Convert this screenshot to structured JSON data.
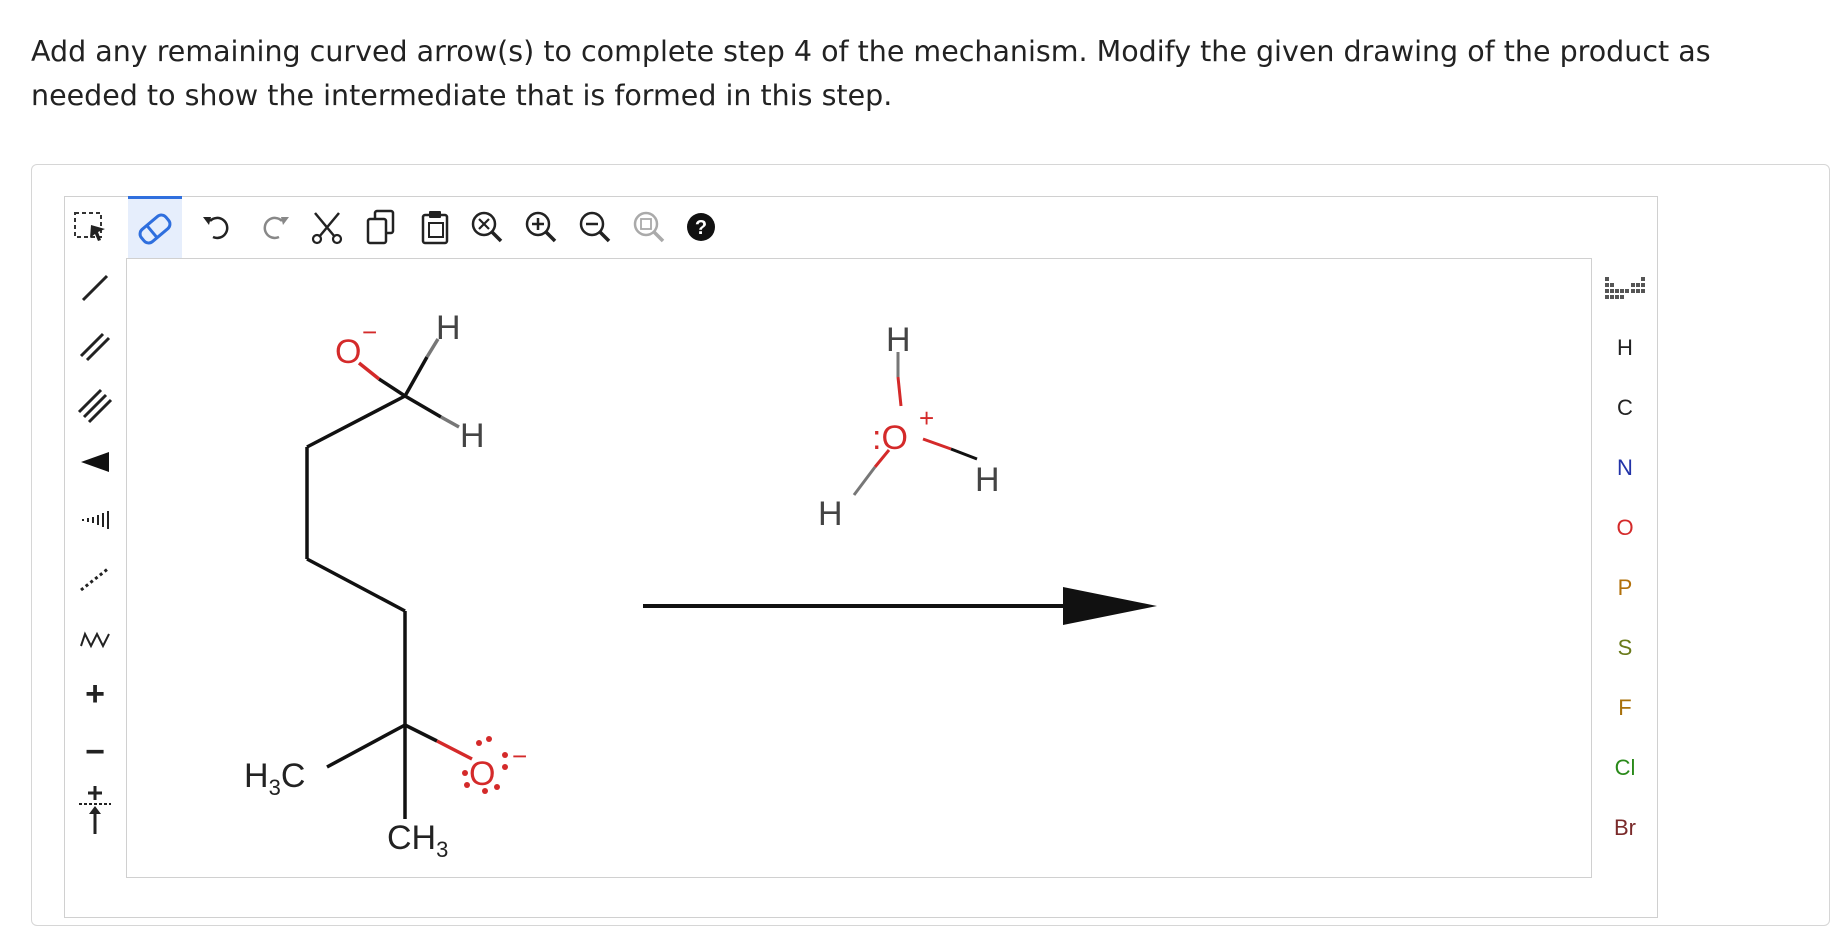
{
  "question": {
    "text": "Add any remaining curved arrow(s) to complete step 4 of the mechanism. Modify the given drawing of the product as needed to show the intermediate that is formed in this step."
  },
  "toolbar_top": [
    {
      "name": "select-tool",
      "icon": "lasso-select-icon"
    },
    {
      "name": "eraser-tool",
      "icon": "eraser-icon",
      "active": true
    },
    {
      "name": "undo-button",
      "icon": "undo-icon"
    },
    {
      "name": "redo-button",
      "icon": "redo-icon"
    },
    {
      "name": "cut-button",
      "icon": "scissors-icon"
    },
    {
      "name": "copy-button",
      "icon": "copy-icon"
    },
    {
      "name": "paste-button",
      "icon": "paste-icon"
    },
    {
      "name": "zoom-reset-button",
      "icon": "zoom-reset-icon"
    },
    {
      "name": "zoom-in-button",
      "icon": "zoom-in-icon"
    },
    {
      "name": "zoom-out-button",
      "icon": "zoom-out-icon"
    },
    {
      "name": "zoom-fit-button",
      "icon": "zoom-fit-icon"
    },
    {
      "name": "help-button",
      "icon": "help-icon"
    }
  ],
  "toolbar_left": [
    {
      "name": "single-bond-tool",
      "icon": "single-bond-icon"
    },
    {
      "name": "double-bond-tool",
      "icon": "double-bond-icon"
    },
    {
      "name": "triple-bond-tool",
      "icon": "triple-bond-icon"
    },
    {
      "name": "wedge-bond-tool",
      "icon": "wedge-bond-icon"
    },
    {
      "name": "hash-bond-tool",
      "icon": "hashed-wedge-icon"
    },
    {
      "name": "dashed-bond-tool",
      "icon": "dashed-bond-icon"
    },
    {
      "name": "wavy-bond-tool",
      "icon": "wavy-bond-icon"
    },
    {
      "name": "positive-charge-tool",
      "icon": "plus-charge-icon",
      "label": "+"
    },
    {
      "name": "negative-charge-tool",
      "icon": "minus-charge-icon",
      "label": "−"
    },
    {
      "name": "charge-arrow-tool",
      "icon": "charge-arrow-icon"
    }
  ],
  "elements": [
    {
      "symbol": "H",
      "color": "#222222"
    },
    {
      "symbol": "C",
      "color": "#222222"
    },
    {
      "symbol": "N",
      "color": "#2233a8"
    },
    {
      "symbol": "O",
      "color": "#d42a2a"
    },
    {
      "symbol": "P",
      "color": "#b2700a"
    },
    {
      "symbol": "S",
      "color": "#6a7a1a"
    },
    {
      "symbol": "F",
      "color": "#a8700a"
    },
    {
      "symbol": "Cl",
      "color": "#2a8a1a"
    },
    {
      "symbol": "Br",
      "color": "#7a2a2a"
    }
  ],
  "periodic_table_icon": "periodic-table-icon",
  "molecule": {
    "o_minus_top": "O",
    "o_minus_top_charge": "−",
    "h_top": "H",
    "h_mid": "H",
    "h3c_left": "H",
    "h3c_sub": "3",
    "h3c_c": "C",
    "ch3_c": "CH",
    "ch3_sub": "3",
    "o_bottom": "O",
    "o_bottom_charge": "−"
  },
  "hydronium": {
    "h_top": "H",
    "o": "O",
    "o_charge": "+",
    "h_right": "H",
    "h_left": "H",
    "lone_pair": ":"
  },
  "colors": {
    "oxygen": "#d42a2a",
    "bond": "#111111",
    "accent": "#2f6fde"
  }
}
